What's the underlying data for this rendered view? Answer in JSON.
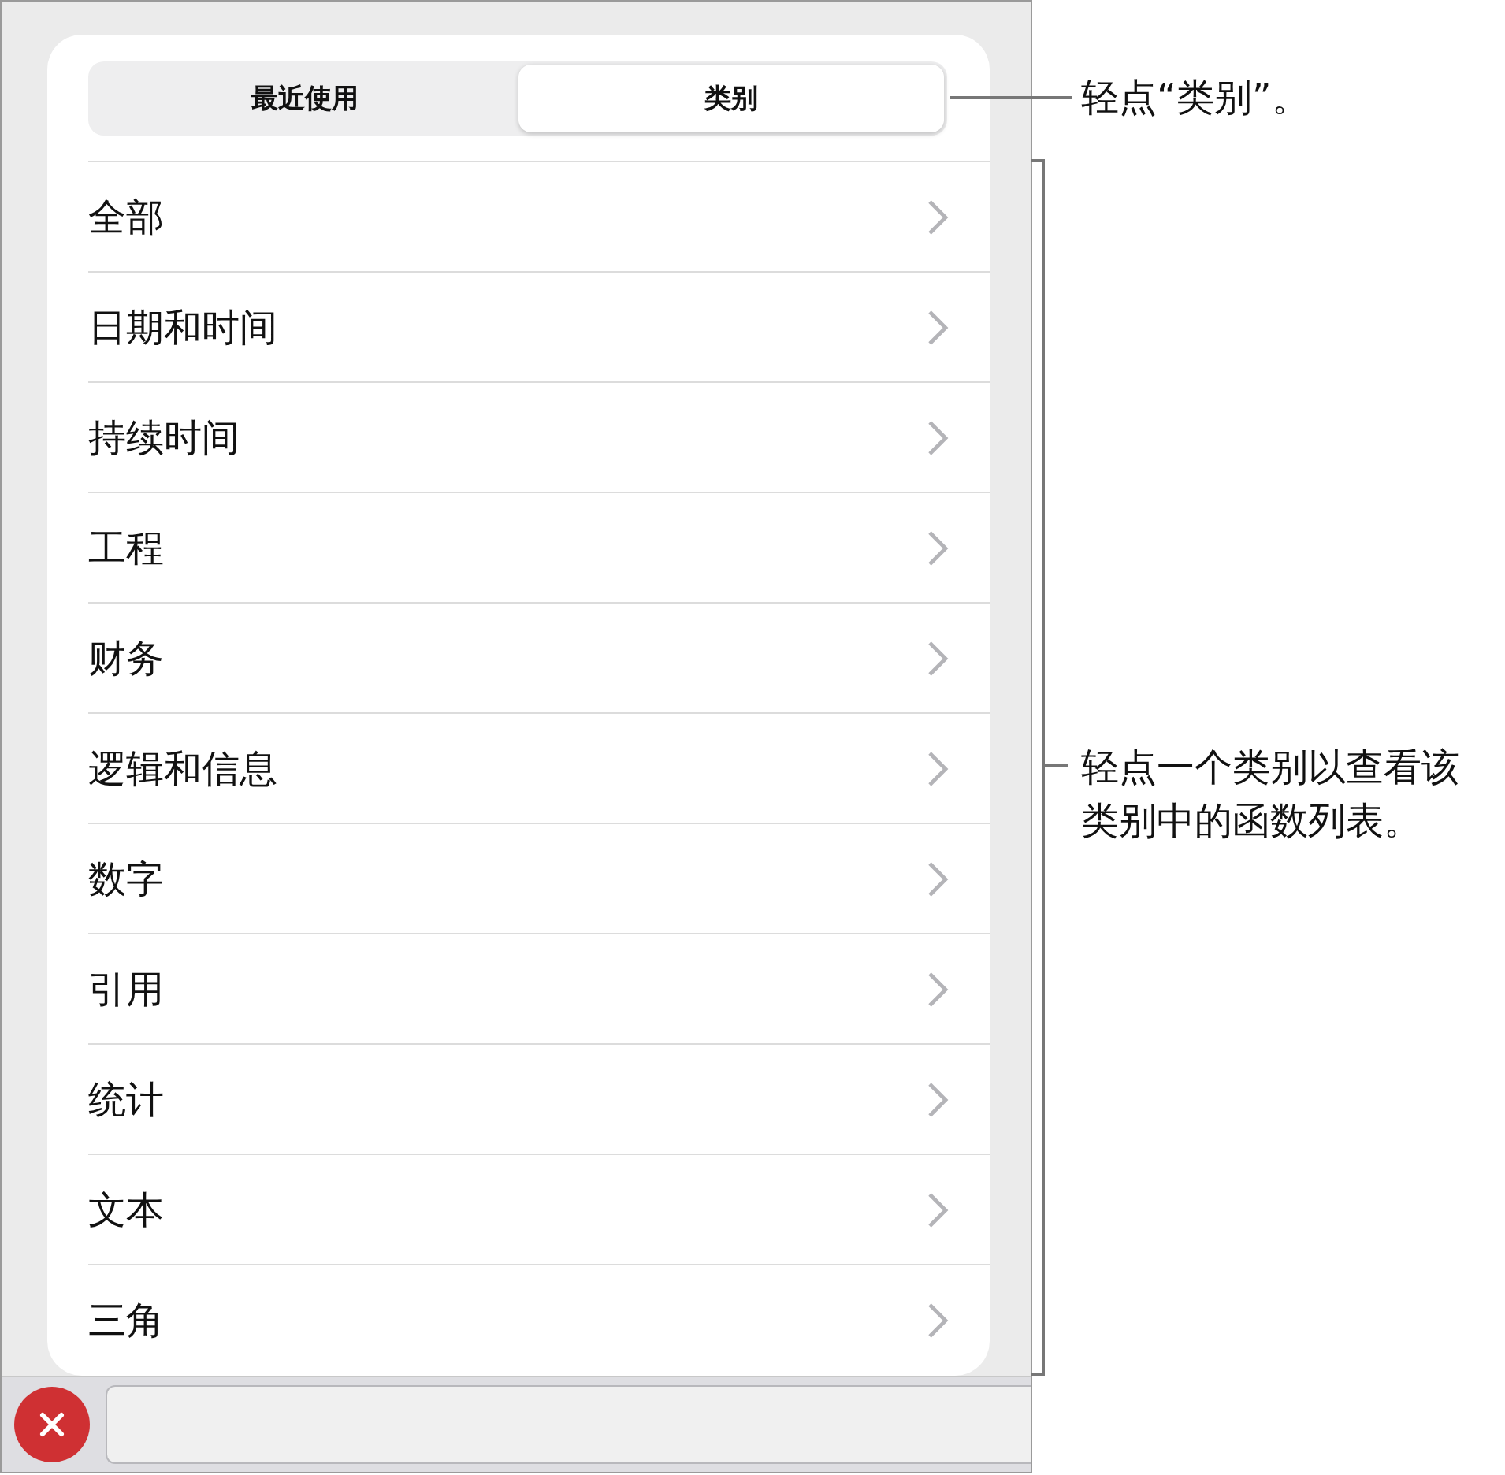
{
  "segments": [
    {
      "label": "最近使用",
      "selected": false
    },
    {
      "label": "类别",
      "selected": true
    }
  ],
  "categories": [
    "全部",
    "日期和时间",
    "持续时间",
    "工程",
    "财务",
    "逻辑和信息",
    "数字",
    "引用",
    "统计",
    "文本",
    "三角"
  ],
  "callouts": [
    {
      "text": "轻点“类别”。",
      "kind": "line"
    },
    {
      "text": "轻点一个类别以查看该类别中的函数列表。",
      "kind": "bracket"
    }
  ]
}
